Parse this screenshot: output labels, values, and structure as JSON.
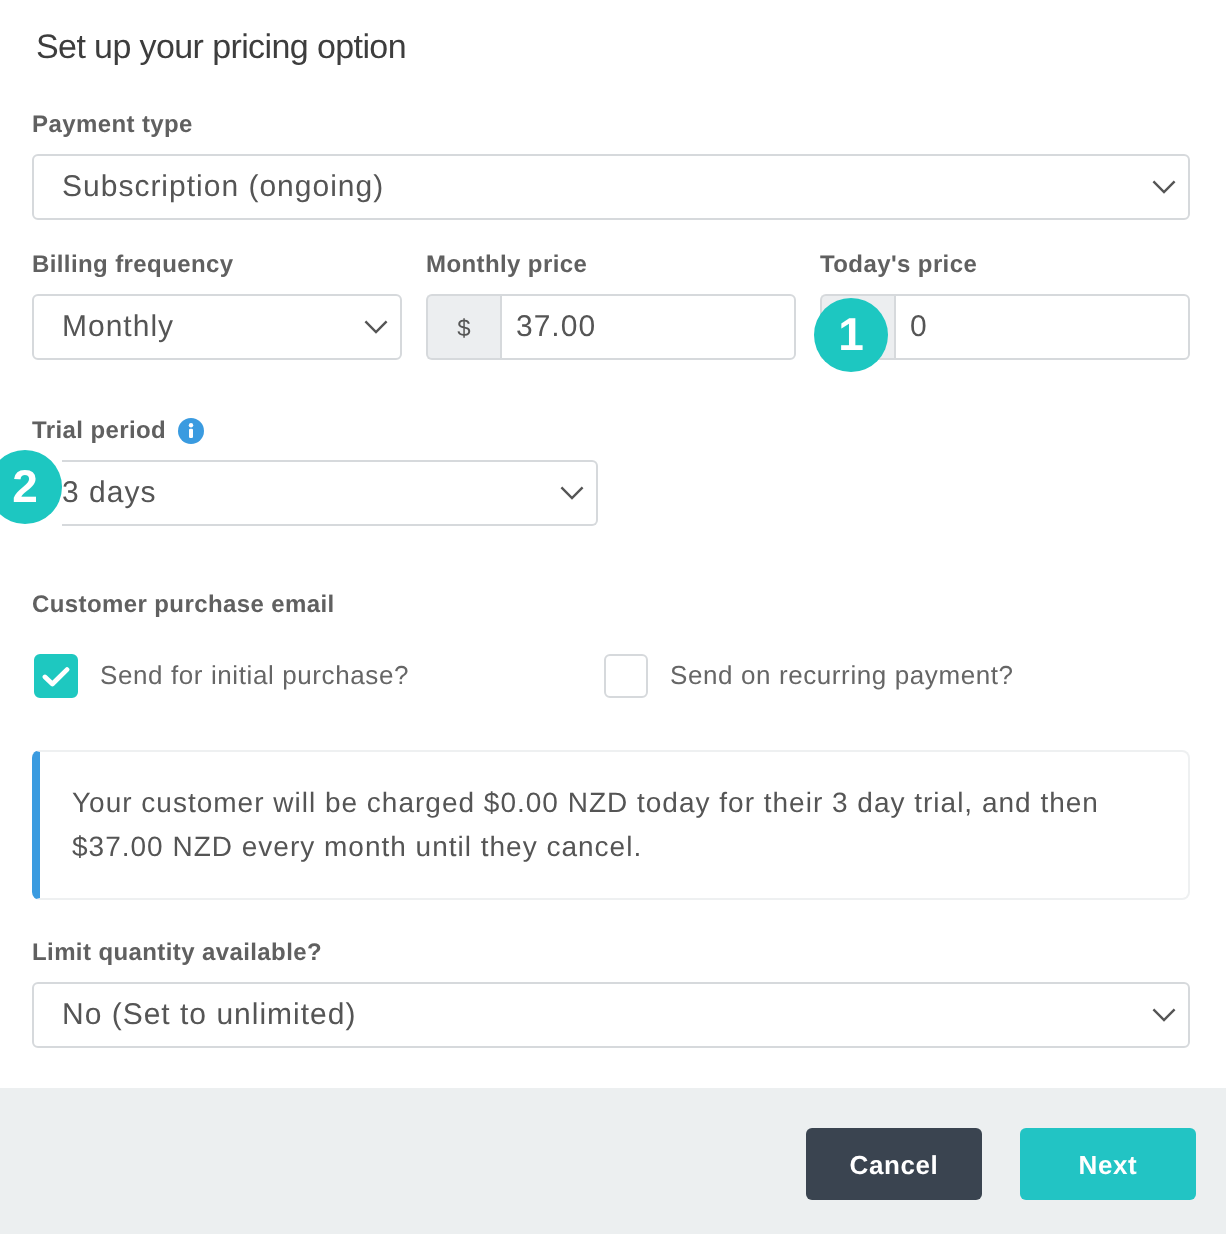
{
  "title": "Set up your pricing option",
  "payment_type": {
    "label": "Payment type",
    "value": "Subscription (ongoing)"
  },
  "pricing_row": [
    {
      "kind": "select",
      "label": "Billing frequency",
      "value": "Monthly"
    },
    {
      "kind": "price",
      "label": "Monthly price",
      "prefix": "$",
      "value": "37.00"
    },
    {
      "kind": "price",
      "label": "Today's price",
      "value": "0",
      "callout": "1"
    }
  ],
  "trial_period": {
    "label": "Trial period",
    "value": "3 days",
    "callout": "2"
  },
  "purchase_email": {
    "label": "Customer purchase email",
    "options": [
      {
        "label": "Send for initial purchase?",
        "checked": true
      },
      {
        "label": "Send on recurring payment?",
        "checked": false
      }
    ]
  },
  "notice": "Your customer will be charged $0.00 NZD today for their 3 day trial, and then $37.00 NZD every month until they cancel.",
  "limit_quantity": {
    "label": "Limit quantity available?",
    "value": "No (Set to unlimited)"
  },
  "buttons": [
    {
      "label": "Cancel",
      "kind": "secondary"
    },
    {
      "label": "Next",
      "kind": "primary"
    }
  ]
}
